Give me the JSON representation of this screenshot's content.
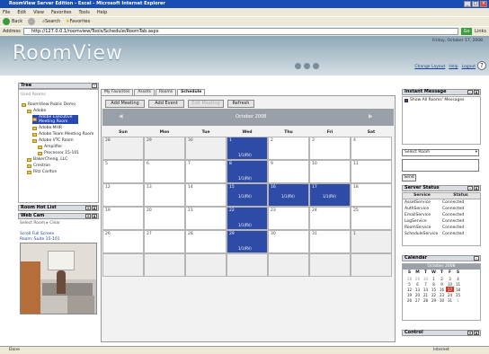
{
  "window": {
    "title": "RoomView Server Edition - Excel - Microsoft Internet Explorer"
  },
  "menu": [
    "File",
    "Edit",
    "View",
    "Favorites",
    "Tools",
    "Help"
  ],
  "toolbar": {
    "back": "Back",
    "search": "Search",
    "favorites": "Favorites"
  },
  "address": {
    "label": "Address",
    "url": "http://127.0.0.1/roomview/Tools/Schedule/RoomTab.aspx",
    "go": "Go",
    "links": "Links"
  },
  "header": {
    "logo": "RoomView",
    "date": "Friday, October 17, 2008",
    "links": [
      "Change Layout",
      "Help",
      "Logout"
    ]
  },
  "tree": {
    "title": "Tree",
    "filter": "Used Rooms",
    "items": [
      {
        "label": "RoomView Public Demo",
        "indent": 0
      },
      {
        "label": "Adobe",
        "indent": 1
      },
      {
        "label": "Adobe Executive Meeting Room",
        "indent": 2,
        "selected": true
      },
      {
        "label": "Adobe MHR",
        "indent": 2
      },
      {
        "label": "Adobe Team Meeting Room",
        "indent": 2
      },
      {
        "label": "Adobe VTC Room",
        "indent": 2
      },
      {
        "label": "Amplifier",
        "indent": 3
      },
      {
        "label": "Processor 15-101",
        "indent": 3
      },
      {
        "label": "BakerCheng, LLC",
        "indent": 1
      },
      {
        "label": "Crestron",
        "indent": 1
      },
      {
        "label": "Ritz Carlton",
        "indent": 1
      }
    ]
  },
  "roomhotlist": {
    "title": "Room Hot List"
  },
  "webcam": {
    "title": "Web Cam",
    "links": "Select Room  ▸ Clear",
    "caption": "Scroll Full Screen",
    "room": "Room: Suite 15-101"
  },
  "tabs": [
    "My Favorites",
    "Assets",
    "Rooms",
    "Schedule"
  ],
  "calendar": {
    "buttons": [
      "Add Meeting",
      "Add Event",
      "Edit Meeting",
      "Refresh"
    ],
    "month": "October 2008",
    "days": [
      "Sun",
      "Mon",
      "Tue",
      "Wed",
      "Thu",
      "Fri",
      "Sat"
    ],
    "weeks": [
      [
        "28",
        "29",
        "30",
        "1",
        "2",
        "3",
        "4"
      ],
      [
        "5",
        "6",
        "7",
        "8",
        "9",
        "10",
        "11"
      ],
      [
        "12",
        "13",
        "14",
        "15",
        "16",
        "17",
        "18"
      ],
      [
        "19",
        "20",
        "21",
        "22",
        "23",
        "24",
        "25"
      ],
      [
        "26",
        "27",
        "28",
        "29",
        "30",
        "31",
        "1"
      ],
      [
        "",
        "",
        "",
        "",
        "",
        "",
        ""
      ]
    ],
    "event": "1/1(RV)"
  },
  "instant": {
    "title": "Instant Message",
    "checkbox": "Show All Rooms' Messages",
    "select": "Select Room",
    "send": "Send"
  },
  "status": {
    "title": "Server Status",
    "cols": [
      "Service",
      "Status"
    ],
    "rows": [
      [
        "AssetService",
        "Connected"
      ],
      [
        "AuthService",
        "Connected"
      ],
      [
        "EmailService",
        "Connected"
      ],
      [
        "LogService",
        "Connected"
      ],
      [
        "RoomService",
        "Connected"
      ],
      [
        "ScheduleService",
        "Connected"
      ]
    ]
  },
  "minical": {
    "title": "Calendar",
    "month": "October 2008",
    "days": [
      "S",
      "M",
      "T",
      "W",
      "T",
      "F",
      "S"
    ],
    "weeks": [
      [
        "28",
        "29",
        "30",
        "1",
        "2",
        "3",
        "4"
      ],
      [
        "5",
        "6",
        "7",
        "8",
        "9",
        "10",
        "11"
      ],
      [
        "12",
        "13",
        "14",
        "15",
        "16",
        "17",
        "18"
      ],
      [
        "19",
        "20",
        "21",
        "22",
        "23",
        "24",
        "25"
      ],
      [
        "26",
        "27",
        "28",
        "29",
        "30",
        "31",
        "1"
      ]
    ]
  },
  "control": {
    "title": "Control"
  },
  "statusbar": {
    "left": "Done",
    "right": "Internet"
  }
}
